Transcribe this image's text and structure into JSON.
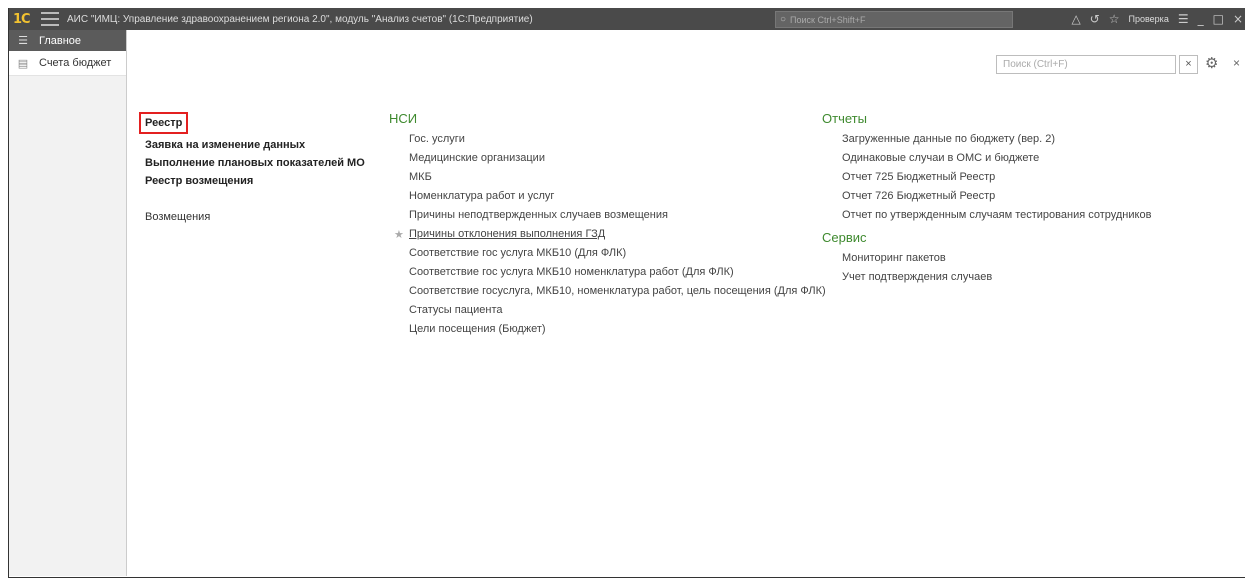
{
  "window": {
    "logo": "1C",
    "title": "АИС \"ИМЦ: Управление здравоохранением региона 2.0\", модуль \"Анализ счетов\" (1С:Предприятие)",
    "global_search_placeholder": "Поиск Ctrl+Shift+F",
    "user_label": "Проверка"
  },
  "sidebar": {
    "items": [
      {
        "label": "Главное",
        "icon": "menu-icon"
      },
      {
        "label": "Счета бюджет",
        "icon": "document-icon"
      }
    ]
  },
  "search": {
    "placeholder": "Поиск (Ctrl+F)",
    "clear_label": "×",
    "close_label": "×"
  },
  "col1": {
    "items": [
      "Реестр",
      "Заявка на изменение данных",
      "Выполнение плановых показателей МО",
      "Реестр возмещения"
    ],
    "extra": "Возмещения"
  },
  "nsi": {
    "title": "НСИ",
    "items": [
      "Гос. услуги",
      "Медицинские организации",
      "МКБ",
      "Номенклатура работ и услуг",
      "Причины неподтвержденных случаев возмещения",
      "Причины отклонения выполнения ГЗД",
      "Соответствие гос услуга МКБ10 (Для ФЛК)",
      "Соответствие гос услуга МКБ10 номенклатура работ (Для ФЛК)",
      "Соответствие госуслуга, МКБ10, номенклатура работ, цель посещения (Для ФЛК)",
      "Статусы пациента",
      "Цели посещения (Бюджет)"
    ]
  },
  "reports": {
    "title": "Отчеты",
    "items": [
      "Загруженные данные по бюджету (вер. 2)",
      "Одинаковые случаи в ОМС и бюджете",
      "Отчет 725 Бюджетный Реестр",
      "Отчет 726 Бюджетный Реестр",
      "Отчет по утвержденным случаям тестирования сотрудников"
    ]
  },
  "service": {
    "title": "Сервис",
    "items": [
      "Мониторинг пакетов",
      "Учет подтверждения случаев"
    ]
  },
  "colors": {
    "section_title": "#3f8a2f",
    "highlight_box": "#e32020",
    "titlebar": "#4a4a4a"
  }
}
